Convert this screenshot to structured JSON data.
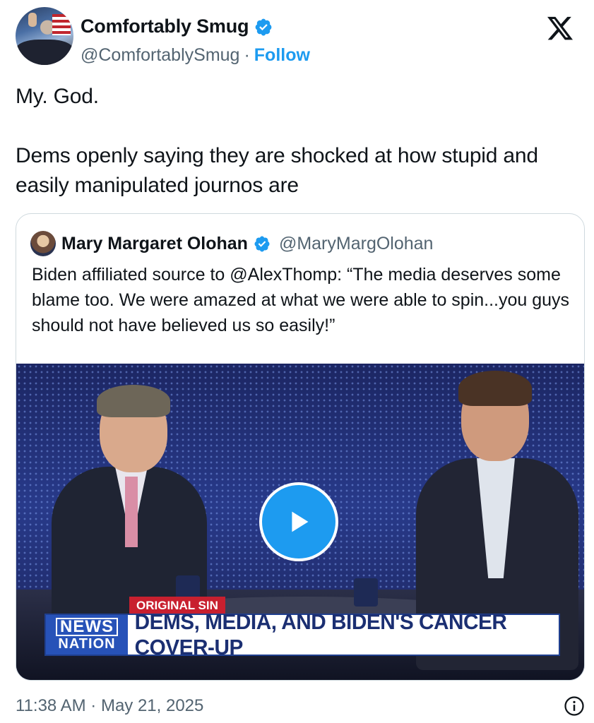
{
  "tweet": {
    "author": {
      "display_name": "Comfortably Smug",
      "handle": "@ComfortablySmug",
      "separator": "·",
      "follow_label": "Follow",
      "verified_icon": "verified-badge-icon"
    },
    "text_line1": "My. God.",
    "text_line2": "Dems openly saying they are shocked at how stupid and easily manipulated journos are",
    "timestamp": "11:38 AM · May 21, 2025"
  },
  "quoted_tweet": {
    "display_name": "Mary Margaret Olohan",
    "handle": "@MaryMargOlohan",
    "text": "Biden affiliated source to @AlexThomp: “The media deserves some blame too. We were amazed at what we were able to spin...you guys should not have believed us so easily!”"
  },
  "video": {
    "chyron_tag": "ORIGINAL SIN",
    "logo_line1": "NEWS",
    "logo_line2": "NATION",
    "headline": "DEMS, MEDIA, AND BIDEN'S CANCER COVER-UP"
  },
  "colors": {
    "accent": "#1d9bf0",
    "secondary_text": "#536471",
    "chyron_red": "#c8202f",
    "chyron_blue": "#2752b8"
  },
  "icons": [
    "x-logo-icon",
    "verified-badge-icon",
    "play-icon",
    "info-icon"
  ]
}
